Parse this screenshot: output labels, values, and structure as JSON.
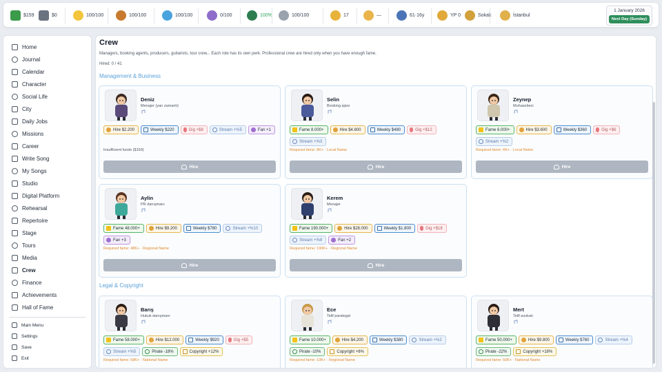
{
  "topbar": {
    "stats": [
      {
        "name": "cash-icon",
        "value": "$159",
        "color": "#3c9a4b"
      },
      {
        "name": "bank-icon",
        "value": "$0",
        "color": "#6b7280"
      },
      {
        "name": "energy-icon",
        "value": "100/100",
        "color": "#f2c53d"
      },
      {
        "name": "hunger-icon",
        "value": "100/100",
        "color": "#c77a2e"
      },
      {
        "name": "thirst-icon",
        "value": "100/100",
        "color": "#4aa3df"
      },
      {
        "name": "potion-icon",
        "value": "0/100",
        "color": "#8e6cc9"
      },
      {
        "name": "health-icon",
        "value": "100%",
        "color": "#2e7d4f"
      },
      {
        "name": "mood-icon",
        "value": "100/100",
        "color": "#9aa3ad"
      },
      {
        "name": "fame-icon",
        "value": "17",
        "color": "#e8b33a"
      },
      {
        "name": "face-icon",
        "value": "—",
        "color": "#e9b44c"
      },
      {
        "name": "age-icon",
        "value": "61·16y",
        "color": "#4b74b8"
      },
      {
        "name": "yp-icon",
        "value": "YP 0",
        "color": "#e0a93a"
      },
      {
        "name": "street-icon",
        "value": "Sokak",
        "color": "#d1a13b"
      },
      {
        "name": "city-icon",
        "value": "İstanbul",
        "color": "#e0b04a"
      }
    ],
    "date": "1 January 2026",
    "next_day_label": "Next Day (Sunday)",
    "next_day_color": "#2f8e5c"
  },
  "sidebar": {
    "items": [
      {
        "label": "Home",
        "icon": "home-icon"
      },
      {
        "label": "Journal",
        "icon": "journal-icon"
      },
      {
        "label": "Calendar",
        "icon": "calendar-icon"
      },
      {
        "label": "Character",
        "icon": "character-icon"
      },
      {
        "label": "Social Life",
        "icon": "social-icon"
      },
      {
        "label": "City",
        "icon": "city-icon"
      },
      {
        "label": "Daily Jobs",
        "icon": "jobs-icon"
      },
      {
        "label": "Missions",
        "icon": "missions-icon"
      },
      {
        "label": "Career",
        "icon": "career-icon"
      },
      {
        "label": "Write Song",
        "icon": "write-song-icon"
      },
      {
        "label": "My Songs",
        "icon": "my-songs-icon"
      },
      {
        "label": "Studio",
        "icon": "studio-icon"
      },
      {
        "label": "Digital Platform",
        "icon": "digital-platform-icon"
      },
      {
        "label": "Rehearsal",
        "icon": "rehearsal-icon"
      },
      {
        "label": "Repertoire",
        "icon": "repertoire-icon"
      },
      {
        "label": "Stage",
        "icon": "stage-icon"
      },
      {
        "label": "Tours",
        "icon": "tours-icon"
      },
      {
        "label": "Media",
        "icon": "media-icon"
      },
      {
        "label": "Crew",
        "icon": "crew-icon"
      },
      {
        "label": "Finance",
        "icon": "finance-icon"
      },
      {
        "label": "Achievements",
        "icon": "achievements-icon"
      },
      {
        "label": "Hall of Fame",
        "icon": "hall-of-fame-icon"
      }
    ],
    "footer": [
      {
        "label": "Main Menu",
        "icon": "main-menu-icon"
      },
      {
        "label": "Settings",
        "icon": "settings-icon"
      },
      {
        "label": "Save",
        "icon": "save-icon"
      },
      {
        "label": "Exit",
        "icon": "exit-icon"
      }
    ],
    "active": "Crew"
  },
  "page": {
    "title": "Crew",
    "description": "Managers, booking agents, producers, guitarists, tour crew... Each role has its own perk. Professional crew are hired only when you have enough fame.",
    "hired": "Hired: 0 / 41",
    "sections": [
      "Management & Business",
      "Legal & Copyright"
    ]
  },
  "cards": [
    {
      "name": "Deniz",
      "role": "Menajer (yarı zamanlı)",
      "hair": "#3b2a20",
      "outfit": "#5a4a7a",
      "tags": [
        {
          "type": "hire",
          "text": "Hire $2.200"
        },
        {
          "type": "weekly",
          "text": "Weekly $220"
        },
        {
          "type": "gig",
          "text": "Gig +$8"
        },
        {
          "type": "stream",
          "text": "Stream +%5"
        },
        {
          "type": "fan",
          "text": "Fan +1"
        }
      ],
      "message": "Insufficient funds ($159)",
      "message_type": "gray",
      "button": "Hire"
    },
    {
      "name": "Selin",
      "role": "Booking ajanı",
      "hair": "#2a1c14",
      "outfit": "#4a5a9a",
      "tags": [
        {
          "type": "fame",
          "text": "Fame 8.000+"
        },
        {
          "type": "hire",
          "text": "Hire $4.800"
        },
        {
          "type": "weekly",
          "text": "Weekly $480"
        },
        {
          "type": "gig",
          "text": "Gig +$12"
        },
        {
          "type": "stream",
          "text": "Stream +%3"
        }
      ],
      "message": "Required fame: 8K+ · Local Name",
      "message_type": "orange",
      "button": "Hire"
    },
    {
      "name": "Zeynep",
      "role": "Muhasebeci",
      "hair": "#3a2617",
      "outfit": "#cfc6ad",
      "tags": [
        {
          "type": "fame",
          "text": "Fame 6.000+"
        },
        {
          "type": "hire",
          "text": "Hire $3.600"
        },
        {
          "type": "weekly",
          "text": "Weekly $360"
        },
        {
          "type": "gig",
          "text": "Gig +$6"
        },
        {
          "type": "stream",
          "text": "Stream +%2"
        }
      ],
      "message": "Required fame: 6K+ · Local Name",
      "message_type": "orange",
      "button": "Hire"
    },
    {
      "name": "Aylin",
      "role": "PR danışmanı",
      "hair": "#5a3524",
      "outfit": "#3ea89a",
      "tags": [
        {
          "type": "fame",
          "text": "Fame 48.000+"
        },
        {
          "type": "hire",
          "text": "Hire $9.200"
        },
        {
          "type": "weekly",
          "text": "Weekly $780"
        },
        {
          "type": "stream",
          "text": "Stream +%10"
        },
        {
          "type": "fan",
          "text": "Fan +3"
        }
      ],
      "message": "Required fame: 48K+ · Regional Name",
      "message_type": "orange",
      "button": "Hire"
    },
    {
      "name": "Kerem",
      "role": "Menajer",
      "hair": "#2a1d15",
      "outfit": "#2f3f6e",
      "tags": [
        {
          "type": "fame",
          "text": "Fame 190.000+"
        },
        {
          "type": "hire",
          "text": "Hire $28.000"
        },
        {
          "type": "weekly",
          "text": "Weekly $1.800"
        },
        {
          "type": "gig",
          "text": "Gig +$18"
        },
        {
          "type": "stream",
          "text": "Stream +%8"
        },
        {
          "type": "fan",
          "text": "Fan +2"
        }
      ],
      "message": "Required fame: 190K+ · Regional Name",
      "message_type": "orange",
      "button": "Hire"
    },
    {
      "name": "Barış",
      "role": "Hukuk danışmanı",
      "hair": "#2a1d15",
      "outfit": "#3a3a44",
      "tags": [
        {
          "type": "fame",
          "text": "Fame 58.000+"
        },
        {
          "type": "hire",
          "text": "Hire $12.000"
        },
        {
          "type": "weekly",
          "text": "Weekly $920"
        },
        {
          "type": "gig",
          "text": "Gig +$5"
        },
        {
          "type": "stream",
          "text": "Stream +%5"
        },
        {
          "type": "pirate",
          "text": "Pirate -18%"
        },
        {
          "type": "copy",
          "text": "Copyright +12%"
        }
      ],
      "message": "Required fame: 58K+ · National Name",
      "message_type": "orange",
      "button": "Hire"
    },
    {
      "name": "Ece",
      "role": "Telif paralegal",
      "hair": "#c79a4a",
      "outfit": "#e7e3d8",
      "tags": [
        {
          "type": "fame",
          "text": "Fame 10.000+"
        },
        {
          "type": "hire",
          "text": "Hire $4.200"
        },
        {
          "type": "weekly",
          "text": "Weekly $380"
        },
        {
          "type": "stream",
          "text": "Stream +%2"
        },
        {
          "type": "pirate",
          "text": "Pirate -10%"
        },
        {
          "type": "copy",
          "text": "Copyright +6%"
        }
      ],
      "message": "Required fame: 10K+ · Regional Name",
      "message_type": "orange",
      "button": "Hire"
    },
    {
      "name": "Mert",
      "role": "Telif avukatı",
      "hair": "#2a1d15",
      "outfit": "#2e2f36",
      "tags": [
        {
          "type": "fame",
          "text": "Fame 50.000+"
        },
        {
          "type": "hire",
          "text": "Hire $9.800"
        },
        {
          "type": "weekly",
          "text": "Weekly $760"
        },
        {
          "type": "stream",
          "text": "Stream +%4"
        },
        {
          "type": "pirate",
          "text": "Pirate -22%"
        },
        {
          "type": "copy",
          "text": "Copyright +18%"
        }
      ],
      "message": "Required fame: 50K+ · National Name",
      "message_type": "orange",
      "button": "Hire"
    }
  ]
}
